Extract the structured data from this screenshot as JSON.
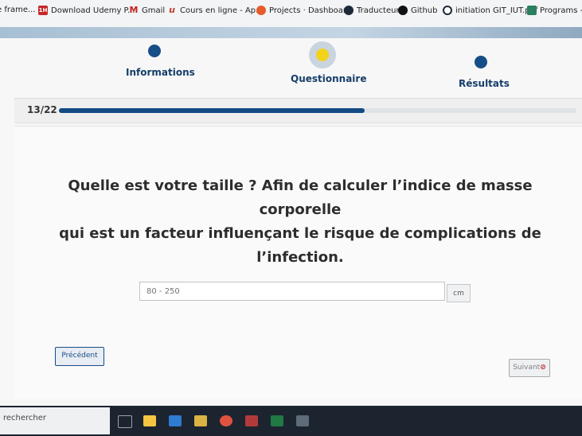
{
  "bookmarks": [
    {
      "label": "e frame...",
      "icon": "frame-icon"
    },
    {
      "label": "Download Udemy P...",
      "icon": "udemy-icon"
    },
    {
      "label": "Gmail",
      "icon": "gmail-icon"
    },
    {
      "label": "Cours en ligne - Ap...",
      "icon": "course-icon"
    },
    {
      "label": "Projects · Dashboar...",
      "icon": "gitlab-icon"
    },
    {
      "label": "Traducteur",
      "icon": "translator-icon"
    },
    {
      "label": "Github",
      "icon": "github-icon"
    },
    {
      "label": "initiation GIT_IUT.pdf",
      "icon": "pdf-icon"
    },
    {
      "label": "Programs - Ut",
      "icon": "programs-icon"
    }
  ],
  "steps": {
    "informations": "Informations",
    "questionnaire": "Questionnaire",
    "resultats": "Résultats"
  },
  "progress": {
    "label": "13/22",
    "current": 13,
    "total": 22
  },
  "question": {
    "line1": "Quelle est votre taille ? Afin de calculer l’indice de masse corporelle",
    "line2": "qui est un facteur influençant le risque de complications de l’infection."
  },
  "height_input": {
    "placeholder": "80 - 250",
    "value": "",
    "unit": "cm"
  },
  "buttons": {
    "previous": "Précédent",
    "next": "Suivant"
  },
  "taskbar": {
    "search_placeholder": "rechercher"
  },
  "colors": {
    "accent": "#164e87",
    "active_step": "#f2d21b"
  }
}
